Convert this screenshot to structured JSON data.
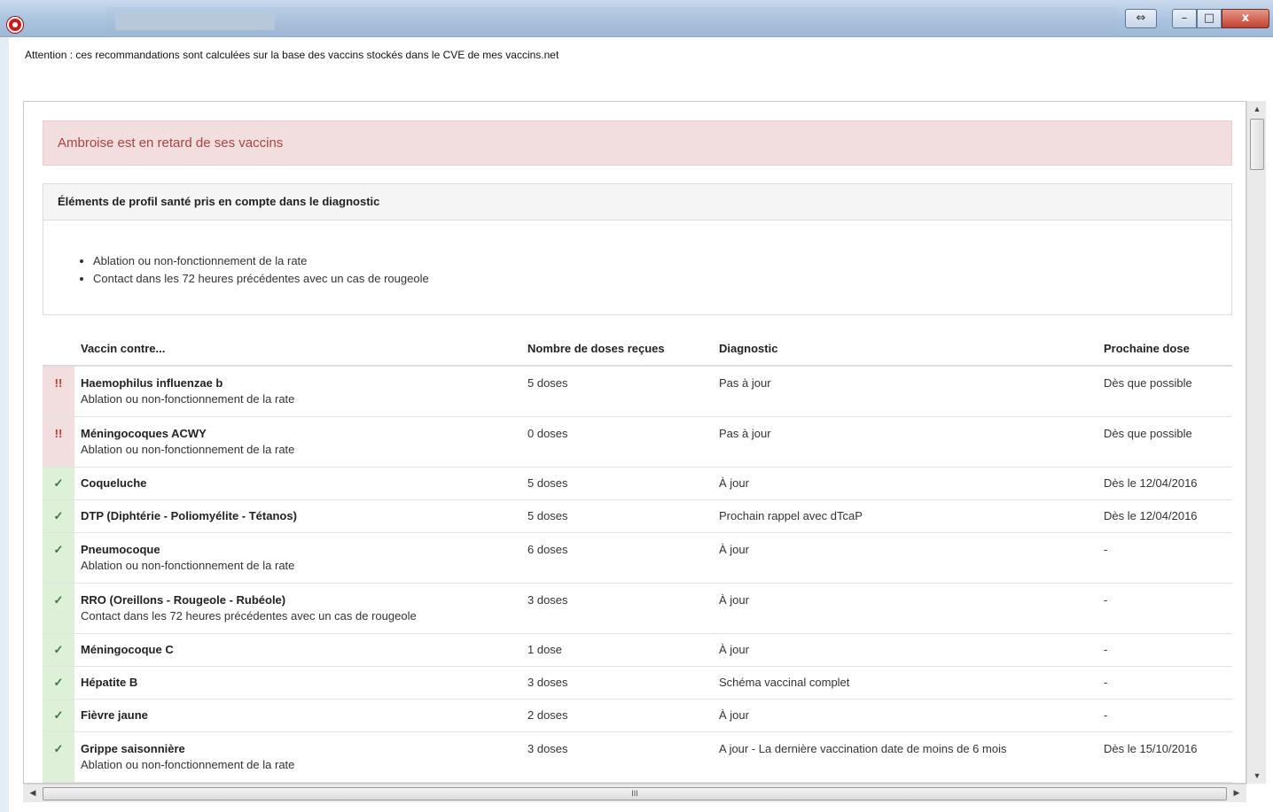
{
  "window": {
    "resize_symbol": "⇔",
    "minimize_symbol": "–",
    "maximize_symbol": "□",
    "close_symbol": "x"
  },
  "warning": "Attention : ces recommandations sont calculées sur la base des vaccins stockés dans le CVE de mes vaccins.net",
  "alert": "Ambroise est en retard de ses vaccins",
  "profile": {
    "heading": "Éléments de profil santé pris en compte dans le diagnostic",
    "items": [
      "Ablation ou non-fonctionnement de la rate",
      "Contact dans les 72 heures précédentes avec un cas de rougeole"
    ]
  },
  "table": {
    "headers": [
      "Vaccin contre...",
      "Nombre de doses reçues",
      "Diagnostic",
      "Prochaine dose"
    ],
    "rows": [
      {
        "status": "!!",
        "name": "Haemophilus influenzae b",
        "note": "Ablation ou non-fonctionnement de la rate",
        "doses": "5 doses",
        "diagnostic": "Pas à jour",
        "next": "Dès que possible"
      },
      {
        "status": "!!",
        "name": "Méningocoques ACWY",
        "note": "Ablation ou non-fonctionnement de la rate",
        "doses": "0 doses",
        "diagnostic": "Pas à jour",
        "next": "Dès que possible"
      },
      {
        "status": "✓",
        "name": "Coqueluche",
        "note": "",
        "doses": "5 doses",
        "diagnostic": "À jour",
        "next": "Dès le 12/04/2016"
      },
      {
        "status": "✓",
        "name": "DTP (Diphtérie - Poliomyélite - Tétanos)",
        "note": "",
        "doses": "5 doses",
        "diagnostic": "Prochain rappel avec dTcaP",
        "next": "Dès le 12/04/2016"
      },
      {
        "status": "✓",
        "name": "Pneumocoque",
        "note": "Ablation ou non-fonctionnement de la rate",
        "doses": "6 doses",
        "diagnostic": "À jour",
        "next": "-"
      },
      {
        "status": "✓",
        "name": "RRO (Oreillons - Rougeole - Rubéole)",
        "note": "Contact dans les 72 heures précédentes avec un cas de rougeole",
        "doses": "3 doses",
        "diagnostic": "À jour",
        "next": "-"
      },
      {
        "status": "✓",
        "name": "Méningocoque C",
        "note": "",
        "doses": "1 dose",
        "diagnostic": "À jour",
        "next": "-"
      },
      {
        "status": "✓",
        "name": "Hépatite B",
        "note": "",
        "doses": "3 doses",
        "diagnostic": "Schéma vaccinal complet",
        "next": "-"
      },
      {
        "status": "✓",
        "name": "Fièvre jaune",
        "note": "",
        "doses": "2 doses",
        "diagnostic": "À jour",
        "next": "-"
      },
      {
        "status": "✓",
        "name": "Grippe saisonnière",
        "note": "Ablation ou non-fonctionnement de la rate",
        "doses": "3 doses",
        "diagnostic": "A jour - La dernière vaccination date de moins de 6 mois",
        "next": "Dès le 15/10/2016"
      }
    ]
  },
  "scrollbar": {
    "grip": "III"
  },
  "colors": {
    "alert_bg": "#f2dede",
    "alert_text": "#a94442",
    "ok_bg": "#dff0d8",
    "ok_mark": "#3c763d",
    "bad_mark": "#c0392b"
  }
}
